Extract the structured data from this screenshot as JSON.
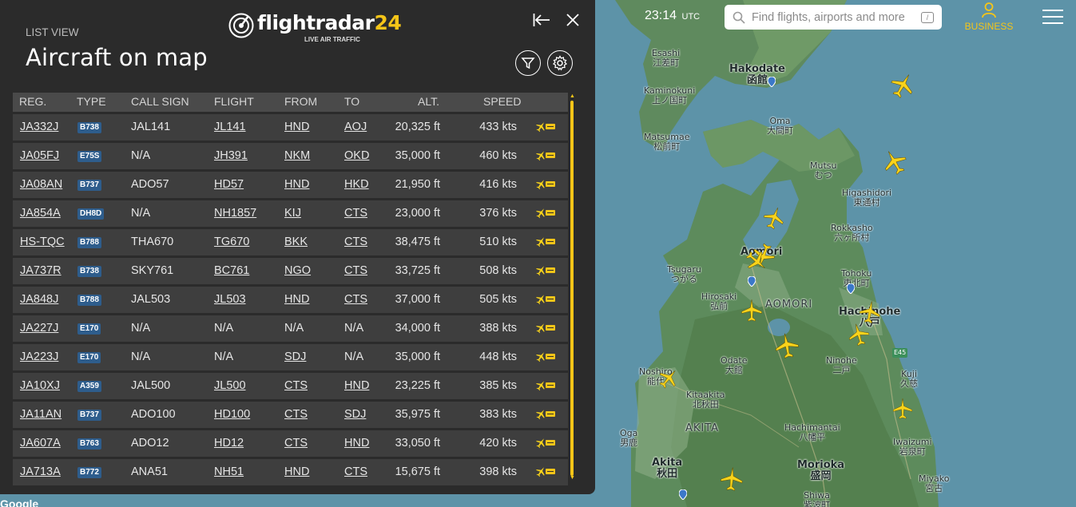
{
  "panel": {
    "mode_label": "LIST VIEW",
    "title": "Aircraft on map",
    "logo": {
      "brand": "flightradar",
      "brand_num": "24",
      "tagline": "LIVE AIR TRAFFIC"
    }
  },
  "table": {
    "headers": [
      "REG.",
      "TYPE",
      "CALL SIGN",
      "FLIGHT",
      "FROM",
      "TO",
      "ALT.",
      "SPEED"
    ],
    "rows": [
      {
        "reg": "JA332J",
        "type": "B738",
        "callsign": "JAL141",
        "flight": "JL141",
        "from": "HND",
        "to": "AOJ",
        "alt": "20,325 ft",
        "speed": "433 kts"
      },
      {
        "reg": "JA05FJ",
        "type": "E75S",
        "callsign": "N/A",
        "flight": "JH391",
        "from": "NKM",
        "to": "OKD",
        "alt": "35,000 ft",
        "speed": "460 kts"
      },
      {
        "reg": "JA08AN",
        "type": "B737",
        "callsign": "ADO57",
        "flight": "HD57",
        "from": "HND",
        "to": "HKD",
        "alt": "21,950 ft",
        "speed": "416 kts"
      },
      {
        "reg": "JA854A",
        "type": "DH8D",
        "callsign": "N/A",
        "flight": "NH1857",
        "from": "KIJ",
        "to": "CTS",
        "alt": "23,000 ft",
        "speed": "376 kts"
      },
      {
        "reg": "HS-TQC",
        "type": "B788",
        "callsign": "THA670",
        "flight": "TG670",
        "from": "BKK",
        "to": "CTS",
        "alt": "38,475 ft",
        "speed": "510 kts"
      },
      {
        "reg": "JA737R",
        "type": "B738",
        "callsign": "SKY761",
        "flight": "BC761",
        "from": "NGO",
        "to": "CTS",
        "alt": "33,725 ft",
        "speed": "508 kts"
      },
      {
        "reg": "JA848J",
        "type": "B788",
        "callsign": "JAL503",
        "flight": "JL503",
        "from": "HND",
        "to": "CTS",
        "alt": "37,000 ft",
        "speed": "505 kts"
      },
      {
        "reg": "JA227J",
        "type": "E170",
        "callsign": "N/A",
        "flight": "N/A",
        "from": "N/A",
        "to": "N/A",
        "alt": "34,000 ft",
        "speed": "388 kts"
      },
      {
        "reg": "JA223J",
        "type": "E170",
        "callsign": "N/A",
        "flight": "N/A",
        "from": "SDJ",
        "to": "N/A",
        "alt": "35,000 ft",
        "speed": "448 kts"
      },
      {
        "reg": "JA10XJ",
        "type": "A359",
        "callsign": "JAL500",
        "flight": "JL500",
        "from": "CTS",
        "to": "HND",
        "alt": "23,225 ft",
        "speed": "385 kts"
      },
      {
        "reg": "JA11AN",
        "type": "B737",
        "callsign": "ADO100",
        "flight": "HD100",
        "from": "CTS",
        "to": "SDJ",
        "alt": "35,975 ft",
        "speed": "383 kts"
      },
      {
        "reg": "JA607A",
        "type": "B763",
        "callsign": "ADO12",
        "flight": "HD12",
        "from": "CTS",
        "to": "HND",
        "alt": "33,050 ft",
        "speed": "420 kts"
      },
      {
        "reg": "JA713A",
        "type": "B772",
        "callsign": "ANA51",
        "flight": "NH51",
        "from": "HND",
        "to": "CTS",
        "alt": "15,675 ft",
        "speed": "398 kts"
      }
    ]
  },
  "topbar": {
    "time": "23:14",
    "timezone": "UTC",
    "search_placeholder": "Find flights, airports and more",
    "search_shortcut": "/",
    "business_label": "BUSINESS"
  },
  "map": {
    "labels": [
      {
        "id": "esashi",
        "text": "Esashi\n江差町"
      },
      {
        "id": "hakodate",
        "text": "Hakodate\n函館"
      },
      {
        "id": "kaminokuni",
        "text": "Kaminokuni\n上ノ国町"
      },
      {
        "id": "oma",
        "text": "Oma\n大間町"
      },
      {
        "id": "matsumae",
        "text": "Matsumae\n松前町"
      },
      {
        "id": "mutsu",
        "text": "Mutsu\nむつ"
      },
      {
        "id": "higashidori",
        "text": "Higashidori\n東通村"
      },
      {
        "id": "rokkasho",
        "text": "Rokkasho\n六ヶ所村"
      },
      {
        "id": "aomori",
        "text": "Aomori"
      },
      {
        "id": "tsugaru",
        "text": "Tsugaru\nつがる"
      },
      {
        "id": "tohoku",
        "text": "Tohoku\n東北町"
      },
      {
        "id": "hirosaki",
        "text": "Hirosaki\n弘前"
      },
      {
        "id": "aomori_pref",
        "text": "AOMORI"
      },
      {
        "id": "hachinohe",
        "text": "Hachinohe\n八戸"
      },
      {
        "id": "odate",
        "text": "Odate\n大館"
      },
      {
        "id": "ninohe",
        "text": "Ninohe\n二戸"
      },
      {
        "id": "noshiro",
        "text": "Noshiro\n能代"
      },
      {
        "id": "kitaakita",
        "text": "Kitaakita\n北秋田"
      },
      {
        "id": "kuji",
        "text": "Kuji\n久慈"
      },
      {
        "id": "akita_pref",
        "text": "AKITA"
      },
      {
        "id": "hachimantai",
        "text": "Hachimantai\n八幡平"
      },
      {
        "id": "iwaizumi",
        "text": "Iwaizumi\n岩泉町"
      },
      {
        "id": "oga",
        "text": "Oga\n男鹿"
      },
      {
        "id": "akita",
        "text": "Akita\n秋田"
      },
      {
        "id": "morioka",
        "text": "Morioka\n盛岡"
      },
      {
        "id": "miyako",
        "text": "Miyako\n宮古"
      },
      {
        "id": "shiwa",
        "text": "Shiwa\n紫波町"
      },
      {
        "id": "e45",
        "text": "E45"
      }
    ],
    "attribution": "Google"
  },
  "colors": {
    "accent": "#f5c518",
    "panel": "#2b2b2b",
    "row": "#3e3e3e",
    "type_badge": "#2e5d8c"
  }
}
